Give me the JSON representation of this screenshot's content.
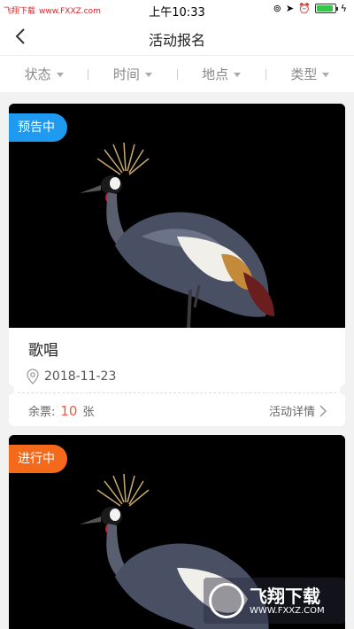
{
  "status_bar": {
    "left_text": "飞翔下载",
    "left_site": "www.FXXZ.com",
    "time": "上午10:33",
    "battery_level": 0.8
  },
  "nav": {
    "title": "活动报名"
  },
  "filters": [
    {
      "label": "状态"
    },
    {
      "label": "时间"
    },
    {
      "label": "地点"
    },
    {
      "label": "类型"
    }
  ],
  "cards": [
    {
      "badge": "预告中",
      "badge_color": "#1e9bf0",
      "name": "歌唱",
      "date": "2018-11-23",
      "tickets_label": "余票:",
      "tickets_count": "10",
      "tickets_unit": "张",
      "detail_label": "活动详情"
    },
    {
      "badge": "进行中",
      "badge_color": "#f56a1a"
    }
  ],
  "watermark": {
    "brand": "飞翔下载",
    "url": "WWW.FXXZ.COM"
  }
}
